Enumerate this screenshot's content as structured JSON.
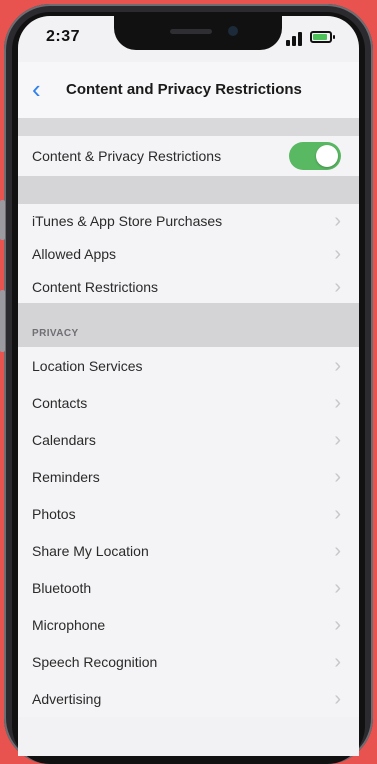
{
  "status_bar": {
    "time": "2:37"
  },
  "nav": {
    "back_icon": "chevron-left-icon",
    "title": "Content and Privacy Restrictions"
  },
  "master_toggle": {
    "label": "Content & Privacy Restrictions",
    "on": true,
    "color_on": "#59b862"
  },
  "purchases_group": [
    {
      "label": "iTunes & App Store Purchases"
    },
    {
      "label": "Allowed Apps"
    },
    {
      "label": "Content Restrictions"
    }
  ],
  "privacy": {
    "header": "PRIVACY",
    "items": [
      {
        "label": "Location Services"
      },
      {
        "label": "Contacts"
      },
      {
        "label": "Calendars"
      },
      {
        "label": "Reminders"
      },
      {
        "label": "Photos"
      },
      {
        "label": "Share My Location"
      },
      {
        "label": "Bluetooth"
      },
      {
        "label": "Microphone"
      },
      {
        "label": "Speech Recognition"
      },
      {
        "label": "Advertising"
      }
    ]
  },
  "colors": {
    "background": "#e8524f",
    "accent": "#2f80ed"
  }
}
